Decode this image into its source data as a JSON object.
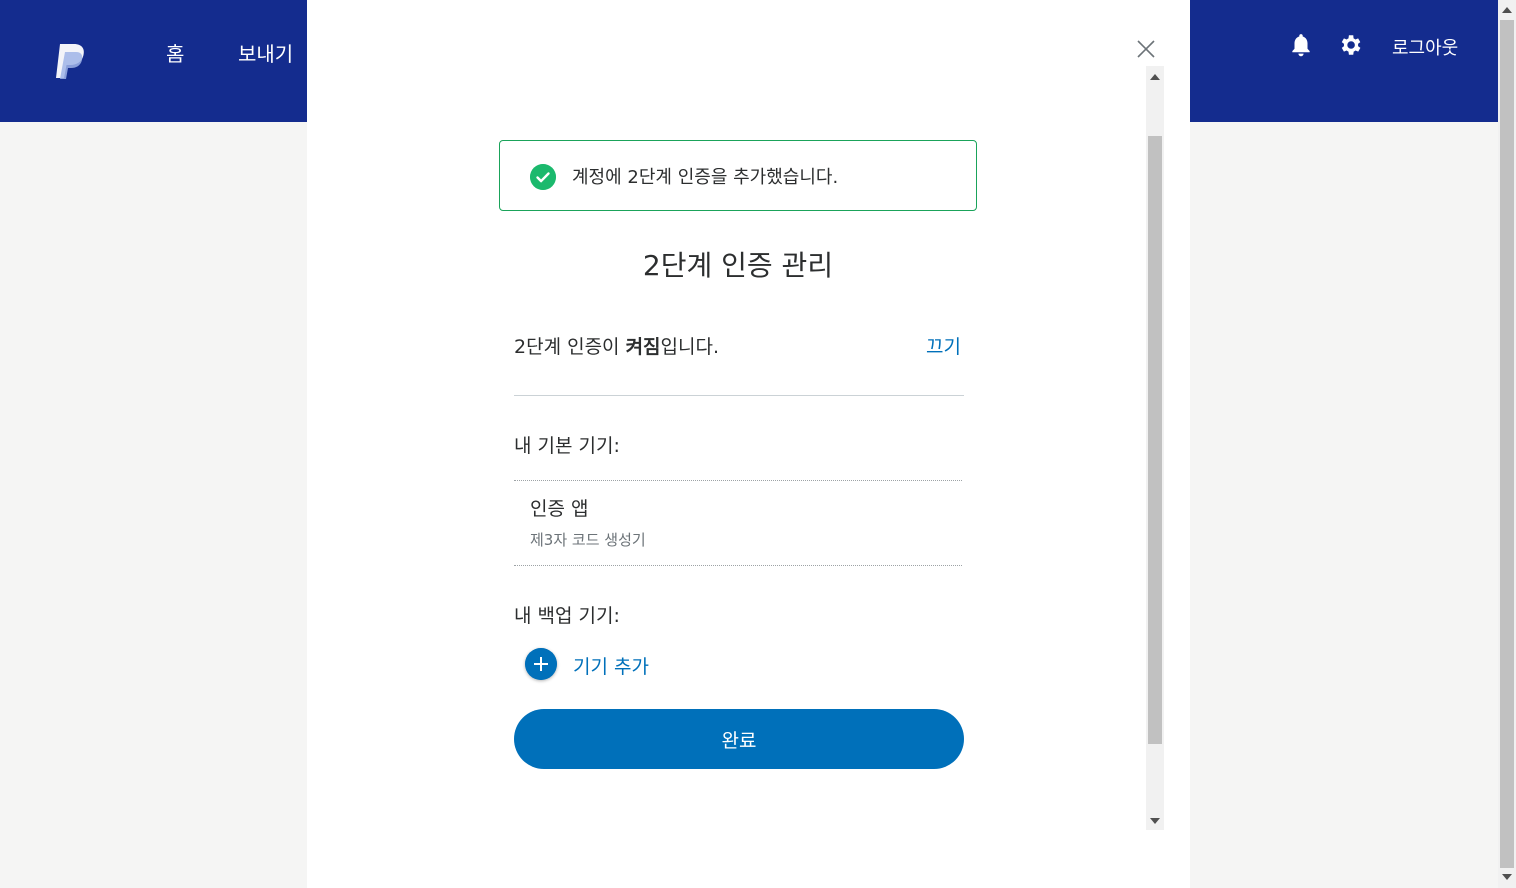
{
  "header": {
    "nav": [
      "홈",
      "보내기"
    ],
    "logout_label": "로그아웃"
  },
  "alert": {
    "message": "계정에 2단계 인증을 추가했습니다."
  },
  "modal": {
    "title": "2단계 인증 관리",
    "status_prefix": "2단계 인증이 ",
    "status_bold": "켜짐",
    "status_suffix": "입니다.",
    "turn_off_label": "끄기",
    "primary_section_label": "내 기본 기기:",
    "primary_device": {
      "name": "인증 앱",
      "description": "제3자 코드 생성기"
    },
    "backup_section_label": "내 백업 기기:",
    "add_device_label": "기기 추가",
    "done_label": "완료"
  },
  "colors": {
    "header_bg": "#142c8e",
    "accent": "#0070ba",
    "success": "#1bb96d"
  }
}
